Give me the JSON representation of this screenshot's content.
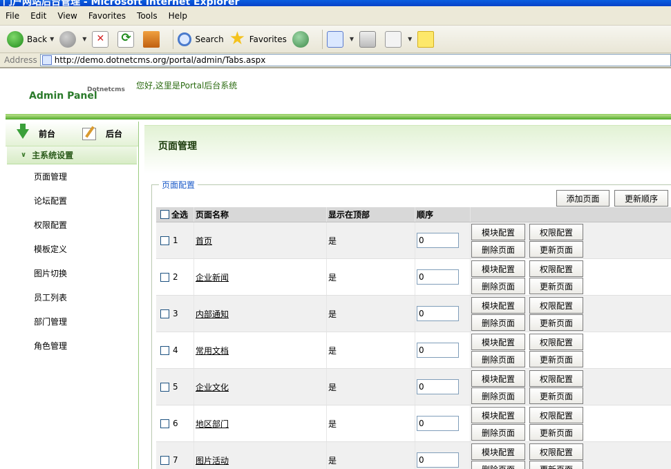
{
  "window": {
    "title": "门户网站后台管理 - Microsoft Internet Explorer"
  },
  "menu": [
    "File",
    "Edit",
    "View",
    "Favorites",
    "Tools",
    "Help"
  ],
  "toolbar": {
    "back_label": "Back",
    "search_label": "Search",
    "favorites_label": "Favorites"
  },
  "address": {
    "label": "Address",
    "url": "http://demo.dotnetcms.org/portal/admin/Tabs.aspx"
  },
  "header": {
    "logo_small": "Dotnetcms",
    "logo_big": "Admin Panel",
    "welcome": "您好,这里是Portal后台系统"
  },
  "sidebar": {
    "front_label": "前台",
    "back_label": "后台",
    "section_title": "主系统设置",
    "items": [
      "页面管理",
      "论坛配置",
      "权限配置",
      "模板定义",
      "图片切换",
      "员工列表",
      "部门管理",
      "角色管理"
    ]
  },
  "main": {
    "title": "页面管理",
    "fieldset_legend": "页面配置",
    "add_button": "添加页面",
    "update_order_button": "更新顺序",
    "columns": {
      "select_all": "全选",
      "name": "页面名称",
      "show_top": "显示在顶部",
      "order": "顺序"
    },
    "actions": {
      "module": "模块配置",
      "permission": "权限配置",
      "delete": "删除页面",
      "update": "更新页面"
    },
    "rows": [
      {
        "num": "1",
        "name": "首页",
        "show_top": "是",
        "order": "0"
      },
      {
        "num": "2",
        "name": "企业新闻",
        "show_top": "是",
        "order": "0"
      },
      {
        "num": "3",
        "name": "内部通知",
        "show_top": "是",
        "order": "0"
      },
      {
        "num": "4",
        "name": "常用文档",
        "show_top": "是",
        "order": "0"
      },
      {
        "num": "5",
        "name": "企业文化",
        "show_top": "是",
        "order": "0"
      },
      {
        "num": "6",
        "name": "地区部门",
        "show_top": "是",
        "order": "0"
      },
      {
        "num": "7",
        "name": "图片活动",
        "show_top": "是",
        "order": "0"
      }
    ]
  }
}
